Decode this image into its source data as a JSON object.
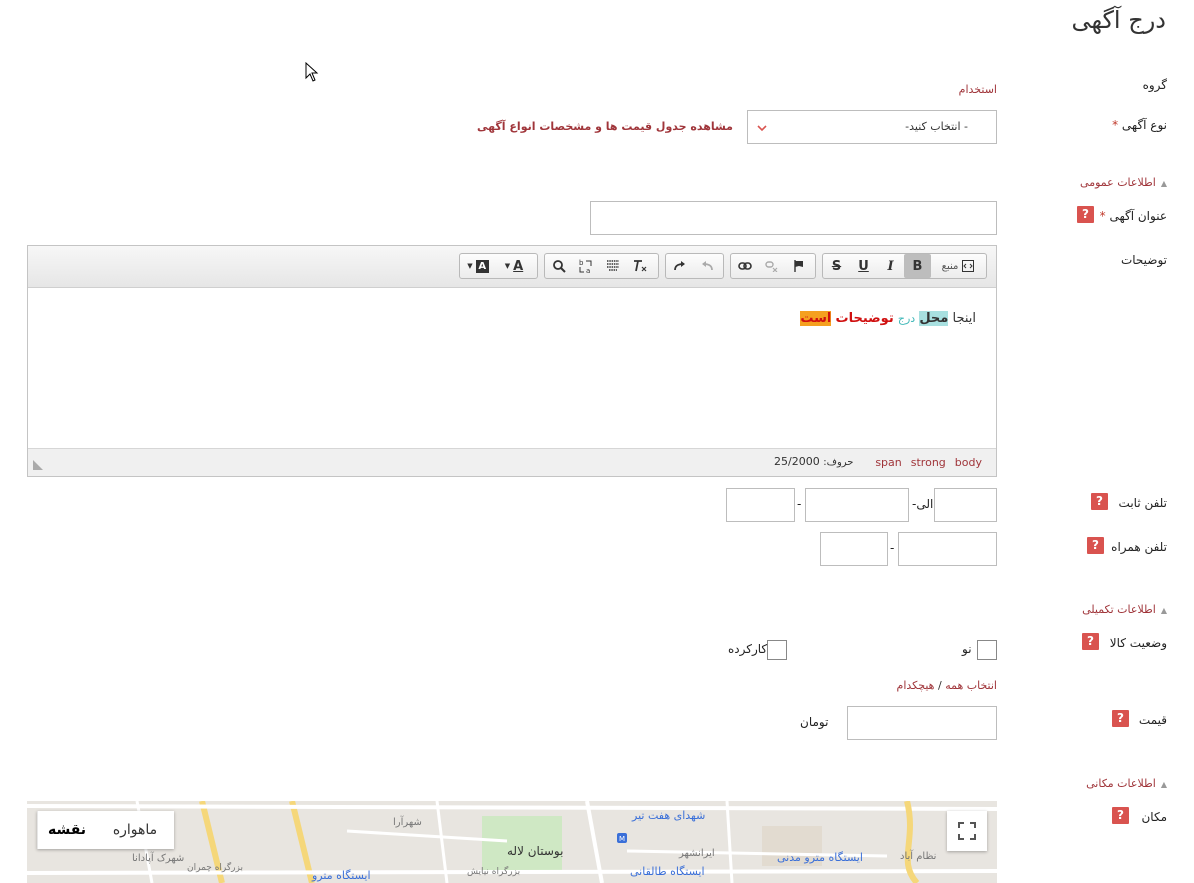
{
  "page": {
    "title": "درج آگهی"
  },
  "form": {
    "group_label": "گروه",
    "group_value": "استخدام",
    "ad_type_label": "نوع آگهی",
    "required_mark": "*",
    "ad_type_select": "- انتخاب کنید-",
    "price_table_link": "مشاهده جدول قیمت ها و مشخصات انواع آگهی",
    "section_general": "اطلاعات عمومی",
    "title_label": "عنوان آگهی",
    "description_label": "توضیحات",
    "landline_label": "تلفن ثابت",
    "range_sep": "الی",
    "dash": "-",
    "mobile_label": "تلفن همراه",
    "section_extra": "اطلاعات تکمیلی",
    "condition_label": "وضعیت کالا",
    "option_new": "نو",
    "option_used": "کارکرده",
    "select_all": "انتخاب همه",
    "slash": "/",
    "select_none": "هیچکدام",
    "price_label": "قیمت",
    "currency": "تومان",
    "section_location": "اطلاعات مکانی",
    "location_label": "مکان",
    "help": "?"
  },
  "editor": {
    "source_label": "منبع",
    "content": {
      "w1": "اینجا",
      "w2": "محل",
      "w3": "درج",
      "w4": "توضیحات",
      "w5": "است"
    },
    "path": {
      "body": "body",
      "strong": "strong",
      "span": "span"
    },
    "char_label": "حروف:",
    "char_count": "25/2000",
    "colors": {
      "w2_bg": "#a8e0e0",
      "w3": "#3fb8b8",
      "w4": "#d01010",
      "w5_bg": "#f5a020",
      "w5": "#d01010"
    }
  },
  "map": {
    "btn_map": "نقشه",
    "btn_satellite": "ماهواره",
    "labels": {
      "l1": "شهدای هفت تیر",
      "l2": "بوستان لاله",
      "l3": "ایستگاه مترو مدنی",
      "l4": "ایستگاه طالقانی",
      "l5": "ایرانشهر",
      "l6": "شهرآرا",
      "l7": "شهرک آپادانا",
      "l8": "بزرگراه چمران",
      "l9": "ایستگاه مترو",
      "l10": "نظام آباد",
      "l11": "بزرگراه نیایش"
    }
  }
}
